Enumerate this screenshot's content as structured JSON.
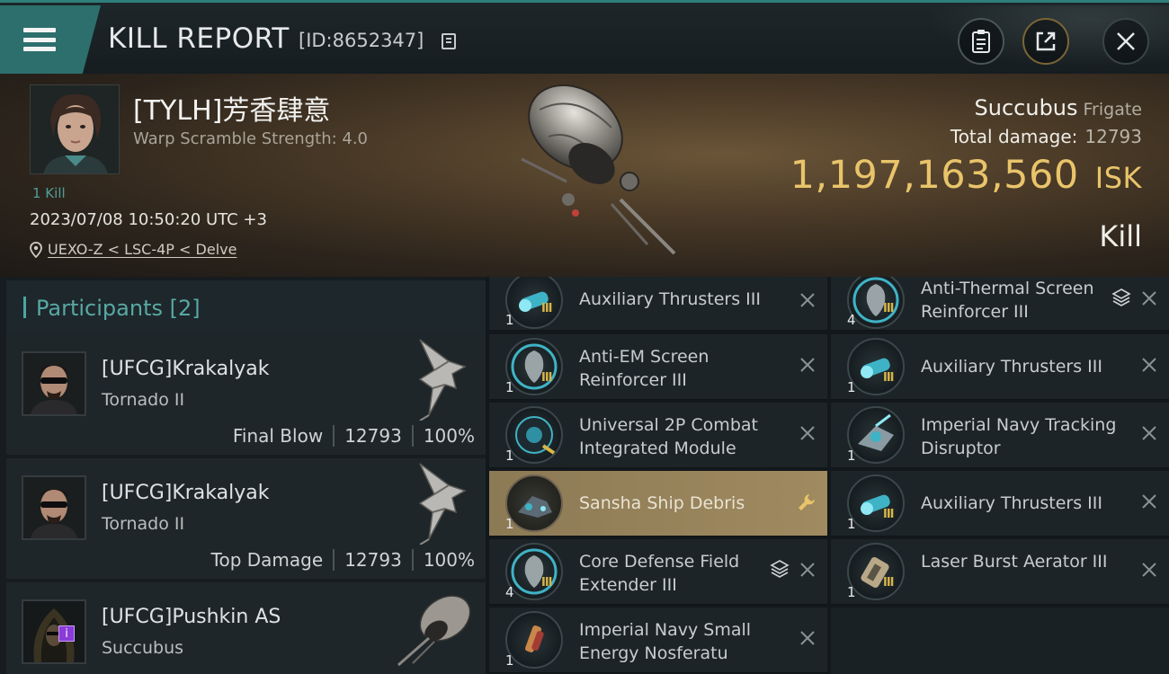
{
  "topbar": {
    "title": "KILL REPORT",
    "report_id": "[ID:8652347]"
  },
  "victim": {
    "name": "[TYLH]芳香肆意",
    "warp_scramble": "Warp Scramble Strength: 4.0",
    "kills": "1 Kill",
    "datetime": "2023/07/08 10:50:20 UTC +3",
    "location": "UEXO-Z < LSC-4P < Delve",
    "ship_name": "Succubus",
    "ship_class": "Frigate",
    "total_damage_label": "Total damage:",
    "total_damage": "12793",
    "isk_value": "1,197,163,560",
    "isk_unit": "ISK",
    "result": "Kill"
  },
  "participants": {
    "title": "Participants [2]",
    "rows": [
      {
        "name": "[UFCG]Krakalyak",
        "ship": "Tornado II",
        "role": "Final Blow",
        "damage": "12793",
        "percent": "100%"
      },
      {
        "name": "[UFCG]Krakalyak",
        "ship": "Tornado II",
        "role": "Top Damage",
        "damage": "12793",
        "percent": "100%"
      },
      {
        "name": "[UFCG]Pushkin AS",
        "ship": "Succubus",
        "badge": "i"
      }
    ]
  },
  "modules": {
    "left": [
      {
        "name": "Auxiliary Thrusters III",
        "qty": "1",
        "tier": "III",
        "icon": "thruster-icon"
      },
      {
        "name": "Anti-EM Screen Reinforcer III",
        "qty": "1",
        "tier": "III",
        "icon": "shield-reinforcer-icon"
      },
      {
        "name": "Universal 2P Combat Integrated Module",
        "qty": "1",
        "tier": "",
        "icon": "combat-module-icon"
      },
      {
        "name": "Sansha Ship Debris",
        "qty": "1",
        "tier": "",
        "icon": "debris-icon"
      },
      {
        "name": "Core Defense Field Extender III",
        "qty": "4",
        "tier": "III",
        "icon": "field-extender-icon"
      },
      {
        "name": "Imperial Navy Small Energy Nosferatu",
        "qty": "1",
        "tier": "",
        "icon": "nosferatu-icon"
      }
    ],
    "right": [
      {
        "name": "Anti-Thermal Screen Reinforcer III",
        "qty": "4",
        "tier": "III",
        "icon": "shield-reinforcer-icon"
      },
      {
        "name": "Auxiliary Thrusters III",
        "qty": "1",
        "tier": "III",
        "icon": "thruster-icon"
      },
      {
        "name": "Imperial Navy Tracking Disruptor",
        "qty": "1",
        "tier": "",
        "icon": "tracking-disruptor-icon"
      },
      {
        "name": "Auxiliary Thrusters III",
        "qty": "1",
        "tier": "III",
        "icon": "thruster-icon"
      },
      {
        "name": "Laser Burst Aerator III",
        "qty": "1",
        "tier": "III",
        "icon": "aerator-icon"
      }
    ]
  },
  "colors": {
    "accent_teal": "#2d6f6d",
    "isk_gold": "#e9c46a",
    "highlight_row": "#a08a60",
    "tier_gold": "#d9b648"
  }
}
